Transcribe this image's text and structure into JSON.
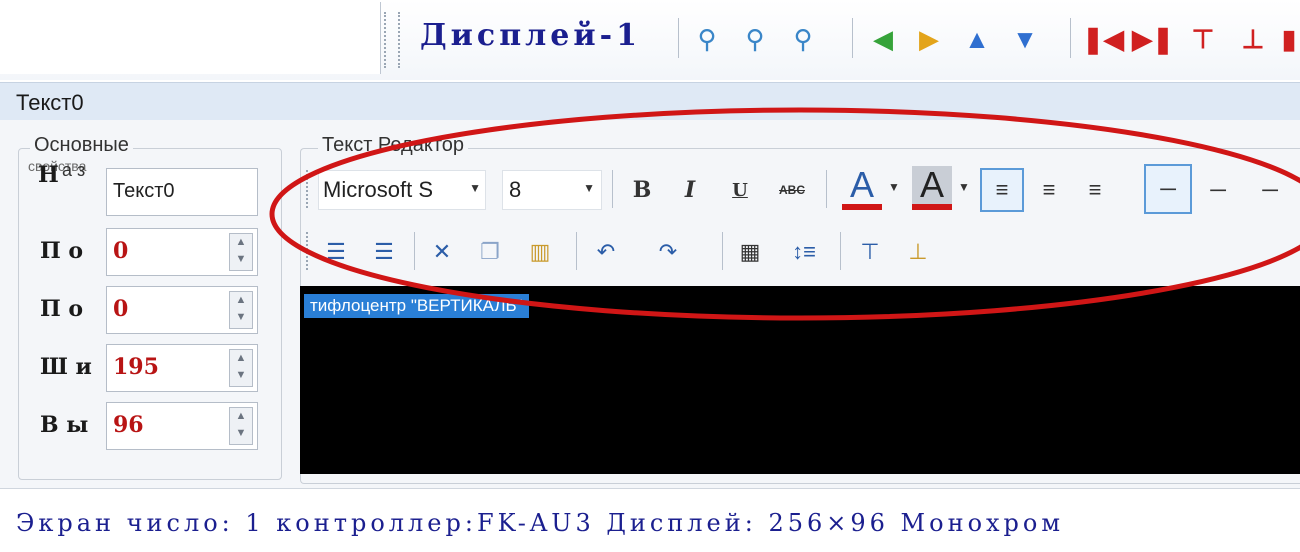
{
  "toolbar": {
    "display_label": "Дисплей-1",
    "icons": [
      "zoom-icon",
      "zoom-in-icon",
      "zoom-out-icon",
      "arrow-left-icon",
      "arrow-right-icon",
      "arrow-up-icon",
      "arrow-down-icon",
      "align-first-icon",
      "align-last-icon",
      "align-top-icon",
      "align-bottom-icon"
    ]
  },
  "header": {
    "title": "Текст0"
  },
  "basic": {
    "title": "Основные",
    "cut_title": "свойства",
    "name_label": "Н",
    "name_small": "а з",
    "name_value": "Текст0",
    "props": [
      {
        "label": "П о",
        "value": "0"
      },
      {
        "label": "П о",
        "value": "0"
      },
      {
        "label": "Ш и",
        "value": "195"
      },
      {
        "label": "В ы",
        "value": "96"
      }
    ]
  },
  "editor": {
    "title": "Текст Редактор",
    "font_name": "Microsoft S",
    "font_size": "8",
    "bold": "B",
    "italic": "I",
    "underline": "U",
    "strike": "ABC",
    "font_color": "A",
    "highlight_color": "A",
    "selected_text": "тифлоцентр \"ВЕРТИКАЛЬ\""
  },
  "status": {
    "text": "Экран число: 1 контроллер:FK-AU3 Дисплей: 256×96 Монохром"
  },
  "colors": {
    "accent_blue": "#1b1f8f",
    "value_red": "#b81414",
    "annotation_red": "#d01616",
    "selection_blue": "#2a7fd6"
  }
}
